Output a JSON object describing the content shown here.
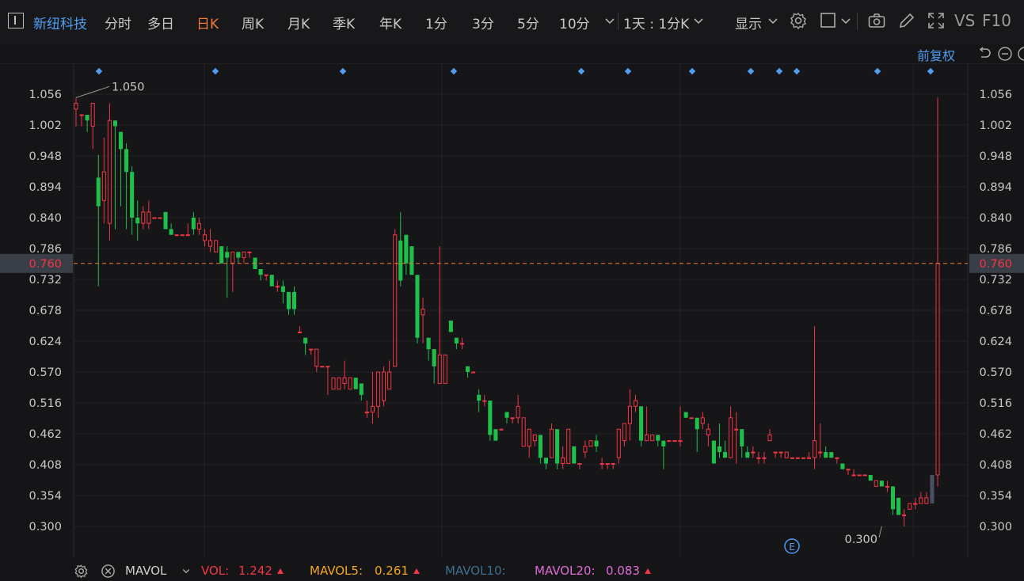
{
  "toolbar": {
    "stock_name": "新纽科技",
    "periods": [
      "分时",
      "多日",
      "日K",
      "周K",
      "月K",
      "季K",
      "年K",
      "1分",
      "3分",
      "5分",
      "10分"
    ],
    "active_period": "日K",
    "interval_label": "1天 : 1分K",
    "display_label": "显示",
    "vs_label": "VS",
    "f10_label": "F10"
  },
  "subbar": {
    "adjust_label": "前复权"
  },
  "price_axis": {
    "ticks": [
      "1.056",
      "1.002",
      "0.948",
      "0.894",
      "0.840",
      "0.786",
      "0.732",
      "0.678",
      "0.624",
      "0.570",
      "0.516",
      "0.462",
      "0.408",
      "0.354",
      "0.300"
    ],
    "current_price": "0.760",
    "high_label": "1.050",
    "low_label": "0.300"
  },
  "event_marker": "E",
  "indicator_bar": {
    "name": "MAVOL",
    "vol_label": "VOL:",
    "vol_value": "1.242",
    "mavol5_label": "MAVOL5:",
    "mavol5_value": "0.261",
    "mavol10_label": "MAVOL10:",
    "mavol20_label": "MAVOL20:",
    "mavol20_value": "0.083"
  },
  "colors": {
    "up": "#f23645",
    "down": "#1fbf4c",
    "accent": "#f07a3a",
    "link": "#4f9cf0",
    "mavol5": "#f5a623",
    "mavol10": "#3d6f8f",
    "mavol20": "#e26bd6"
  },
  "chart_data": {
    "type": "candlestick",
    "y_range": [
      0.27,
      1.08
    ],
    "candles": [
      [
        1.03,
        1.04,
        1.05,
        1.0
      ],
      [
        1.02,
        1.02,
        1.02,
        1.0
      ],
      [
        1.02,
        1.01,
        1.02,
        0.99
      ],
      [
        1.0,
        1.04,
        1.04,
        0.96
      ],
      [
        0.91,
        0.86,
        0.95,
        0.72
      ],
      [
        0.87,
        0.92,
        0.98,
        0.83
      ],
      [
        0.83,
        1.01,
        1.04,
        0.8
      ],
      [
        1.01,
        1.0,
        1.01,
        0.82
      ],
      [
        0.99,
        0.96,
        0.99,
        0.86
      ],
      [
        0.96,
        0.92,
        0.97,
        0.82
      ],
      [
        0.92,
        0.84,
        0.93,
        0.81
      ],
      [
        0.84,
        0.83,
        0.87,
        0.8
      ],
      [
        0.83,
        0.85,
        0.86,
        0.82
      ],
      [
        0.83,
        0.85,
        0.87,
        0.82
      ],
      [
        0.84,
        0.84,
        0.84,
        0.84
      ],
      [
        0.84,
        0.84,
        0.84,
        0.84
      ],
      [
        0.85,
        0.82,
        0.85,
        0.82
      ],
      [
        0.82,
        0.81,
        0.83,
        0.81
      ],
      [
        0.81,
        0.81,
        0.81,
        0.81
      ],
      [
        0.81,
        0.81,
        0.81,
        0.81
      ],
      [
        0.81,
        0.81,
        0.83,
        0.81
      ],
      [
        0.84,
        0.82,
        0.85,
        0.81
      ],
      [
        0.82,
        0.83,
        0.84,
        0.81
      ],
      [
        0.8,
        0.81,
        0.82,
        0.79
      ],
      [
        0.79,
        0.8,
        0.82,
        0.78
      ],
      [
        0.78,
        0.8,
        0.8,
        0.78
      ],
      [
        0.79,
        0.76,
        0.79,
        0.76
      ],
      [
        0.78,
        0.77,
        0.79,
        0.7
      ],
      [
        0.76,
        0.78,
        0.78,
        0.71
      ],
      [
        0.78,
        0.77,
        0.78,
        0.76
      ],
      [
        0.77,
        0.78,
        0.78,
        0.76
      ],
      [
        0.78,
        0.78,
        0.78,
        0.77
      ],
      [
        0.77,
        0.75,
        0.77,
        0.75
      ],
      [
        0.75,
        0.74,
        0.75,
        0.73
      ],
      [
        0.74,
        0.74,
        0.74,
        0.73
      ],
      [
        0.74,
        0.72,
        0.74,
        0.72
      ],
      [
        0.72,
        0.72,
        0.73,
        0.71
      ],
      [
        0.72,
        0.71,
        0.73,
        0.69
      ],
      [
        0.71,
        0.68,
        0.71,
        0.67
      ],
      [
        0.71,
        0.68,
        0.72,
        0.67
      ],
      [
        0.64,
        0.64,
        0.65,
        0.64
      ],
      [
        0.63,
        0.62,
        0.63,
        0.6
      ],
      [
        0.61,
        0.61,
        0.61,
        0.6
      ],
      [
        0.58,
        0.61,
        0.61,
        0.57
      ],
      [
        0.58,
        0.58,
        0.58,
        0.58
      ],
      [
        0.58,
        0.58,
        0.58,
        0.53
      ],
      [
        0.54,
        0.56,
        0.56,
        0.54
      ],
      [
        0.54,
        0.56,
        0.56,
        0.54
      ],
      [
        0.55,
        0.56,
        0.59,
        0.54
      ],
      [
        0.54,
        0.56,
        0.56,
        0.54
      ],
      [
        0.56,
        0.54,
        0.56,
        0.54
      ],
      [
        0.55,
        0.53,
        0.55,
        0.52
      ],
      [
        0.5,
        0.5,
        0.52,
        0.49
      ],
      [
        0.5,
        0.51,
        0.57,
        0.48
      ],
      [
        0.51,
        0.57,
        0.57,
        0.49
      ],
      [
        0.52,
        0.57,
        0.58,
        0.51
      ],
      [
        0.54,
        0.57,
        0.59,
        0.54
      ],
      [
        0.58,
        0.81,
        0.82,
        0.58
      ],
      [
        0.8,
        0.73,
        0.85,
        0.72
      ],
      [
        0.81,
        0.76,
        0.81,
        0.74
      ],
      [
        0.79,
        0.74,
        0.79,
        0.74
      ],
      [
        0.74,
        0.63,
        0.74,
        0.62
      ],
      [
        0.67,
        0.68,
        0.7,
        0.62
      ],
      [
        0.63,
        0.61,
        0.63,
        0.59
      ],
      [
        0.61,
        0.58,
        0.61,
        0.55
      ],
      [
        0.55,
        0.6,
        0.79,
        0.55
      ],
      [
        0.55,
        0.6,
        0.6,
        0.55
      ],
      [
        0.66,
        0.64,
        0.66,
        0.64
      ],
      [
        0.63,
        0.62,
        0.63,
        0.61
      ],
      [
        0.62,
        0.62,
        0.63,
        0.61
      ],
      [
        0.58,
        0.57,
        0.58,
        0.56
      ],
      [
        0.57,
        0.57,
        0.57,
        0.57
      ],
      [
        0.53,
        0.52,
        0.54,
        0.5
      ],
      [
        0.52,
        0.52,
        0.53,
        0.51
      ],
      [
        0.52,
        0.46,
        0.52,
        0.45
      ],
      [
        0.47,
        0.45,
        0.47,
        0.45
      ],
      [
        0.47,
        0.47,
        0.47,
        0.47
      ],
      [
        0.5,
        0.49,
        0.5,
        0.48
      ],
      [
        0.49,
        0.49,
        0.49,
        0.48
      ],
      [
        0.49,
        0.51,
        0.53,
        0.48
      ],
      [
        0.44,
        0.49,
        0.49,
        0.44
      ],
      [
        0.44,
        0.47,
        0.47,
        0.42
      ],
      [
        0.45,
        0.46,
        0.46,
        0.44
      ],
      [
        0.46,
        0.42,
        0.46,
        0.41
      ],
      [
        0.42,
        0.41,
        0.42,
        0.4
      ],
      [
        0.42,
        0.47,
        0.48,
        0.42
      ],
      [
        0.47,
        0.41,
        0.47,
        0.4
      ],
      [
        0.41,
        0.42,
        0.44,
        0.4
      ],
      [
        0.41,
        0.47,
        0.47,
        0.41
      ],
      [
        0.44,
        0.41,
        0.44,
        0.41
      ],
      [
        0.41,
        0.41,
        0.41,
        0.4
      ],
      [
        0.43,
        0.44,
        0.45,
        0.42
      ],
      [
        0.44,
        0.45,
        0.45,
        0.44
      ],
      [
        0.45,
        0.44,
        0.46,
        0.43
      ],
      [
        0.41,
        0.41,
        0.42,
        0.4
      ],
      [
        0.41,
        0.41,
        0.41,
        0.4
      ],
      [
        0.41,
        0.41,
        0.41,
        0.4
      ],
      [
        0.42,
        0.47,
        0.47,
        0.41
      ],
      [
        0.45,
        0.48,
        0.48,
        0.44
      ],
      [
        0.48,
        0.51,
        0.54,
        0.45
      ],
      [
        0.51,
        0.52,
        0.53,
        0.5
      ],
      [
        0.51,
        0.45,
        0.51,
        0.44
      ],
      [
        0.45,
        0.46,
        0.51,
        0.45
      ],
      [
        0.45,
        0.46,
        0.46,
        0.45
      ],
      [
        0.46,
        0.45,
        0.46,
        0.44
      ],
      [
        0.45,
        0.44,
        0.45,
        0.4
      ],
      [
        0.45,
        0.45,
        0.45,
        0.45
      ],
      [
        0.45,
        0.45,
        0.45,
        0.45
      ],
      [
        0.45,
        0.45,
        0.51,
        0.44
      ],
      [
        0.5,
        0.49,
        0.5,
        0.49
      ],
      [
        0.49,
        0.49,
        0.49,
        0.49
      ],
      [
        0.49,
        0.47,
        0.49,
        0.43
      ],
      [
        0.48,
        0.49,
        0.5,
        0.47
      ],
      [
        0.46,
        0.47,
        0.48,
        0.44
      ],
      [
        0.45,
        0.41,
        0.45,
        0.41
      ],
      [
        0.44,
        0.43,
        0.48,
        0.42
      ],
      [
        0.43,
        0.42,
        0.45,
        0.42
      ],
      [
        0.42,
        0.49,
        0.51,
        0.42
      ],
      [
        0.47,
        0.47,
        0.5,
        0.41
      ],
      [
        0.47,
        0.44,
        0.47,
        0.42
      ],
      [
        0.43,
        0.42,
        0.44,
        0.42
      ],
      [
        0.43,
        0.43,
        0.44,
        0.42
      ],
      [
        0.42,
        0.42,
        0.43,
        0.41
      ],
      [
        0.42,
        0.42,
        0.43,
        0.41
      ],
      [
        0.45,
        0.46,
        0.47,
        0.45
      ],
      [
        0.43,
        0.43,
        0.43,
        0.42
      ],
      [
        0.43,
        0.43,
        0.43,
        0.42
      ],
      [
        0.42,
        0.43,
        0.43,
        0.42
      ],
      [
        0.42,
        0.42,
        0.42,
        0.42
      ],
      [
        0.42,
        0.42,
        0.42,
        0.42
      ],
      [
        0.42,
        0.42,
        0.42,
        0.42
      ],
      [
        0.42,
        0.42,
        0.43,
        0.42
      ],
      [
        0.42,
        0.45,
        0.65,
        0.4
      ],
      [
        0.43,
        0.43,
        0.48,
        0.42
      ],
      [
        0.43,
        0.42,
        0.44,
        0.42
      ],
      [
        0.43,
        0.42,
        0.43,
        0.42
      ],
      [
        0.42,
        0.42,
        0.42,
        0.41
      ],
      [
        0.41,
        0.4,
        0.41,
        0.4
      ],
      [
        0.4,
        0.4,
        0.4,
        0.39
      ],
      [
        0.39,
        0.39,
        0.4,
        0.39
      ],
      [
        0.39,
        0.39,
        0.39,
        0.39
      ],
      [
        0.39,
        0.39,
        0.39,
        0.39
      ],
      [
        0.39,
        0.38,
        0.39,
        0.38
      ],
      [
        0.37,
        0.38,
        0.38,
        0.37
      ],
      [
        0.38,
        0.37,
        0.38,
        0.37
      ],
      [
        0.37,
        0.37,
        0.38,
        0.36
      ],
      [
        0.37,
        0.33,
        0.37,
        0.32
      ],
      [
        0.35,
        0.32,
        0.35,
        0.32
      ],
      [
        0.32,
        0.32,
        0.33,
        0.3
      ],
      [
        0.33,
        0.34,
        0.34,
        0.33
      ],
      [
        0.34,
        0.34,
        0.35,
        0.33
      ],
      [
        0.34,
        0.35,
        0.36,
        0.34
      ],
      [
        0.34,
        0.35,
        0.36,
        0.34
      ],
      [
        0.39,
        0.34,
        0.39,
        0.34
      ],
      [
        0.39,
        0.76,
        1.05,
        0.37
      ]
    ]
  }
}
